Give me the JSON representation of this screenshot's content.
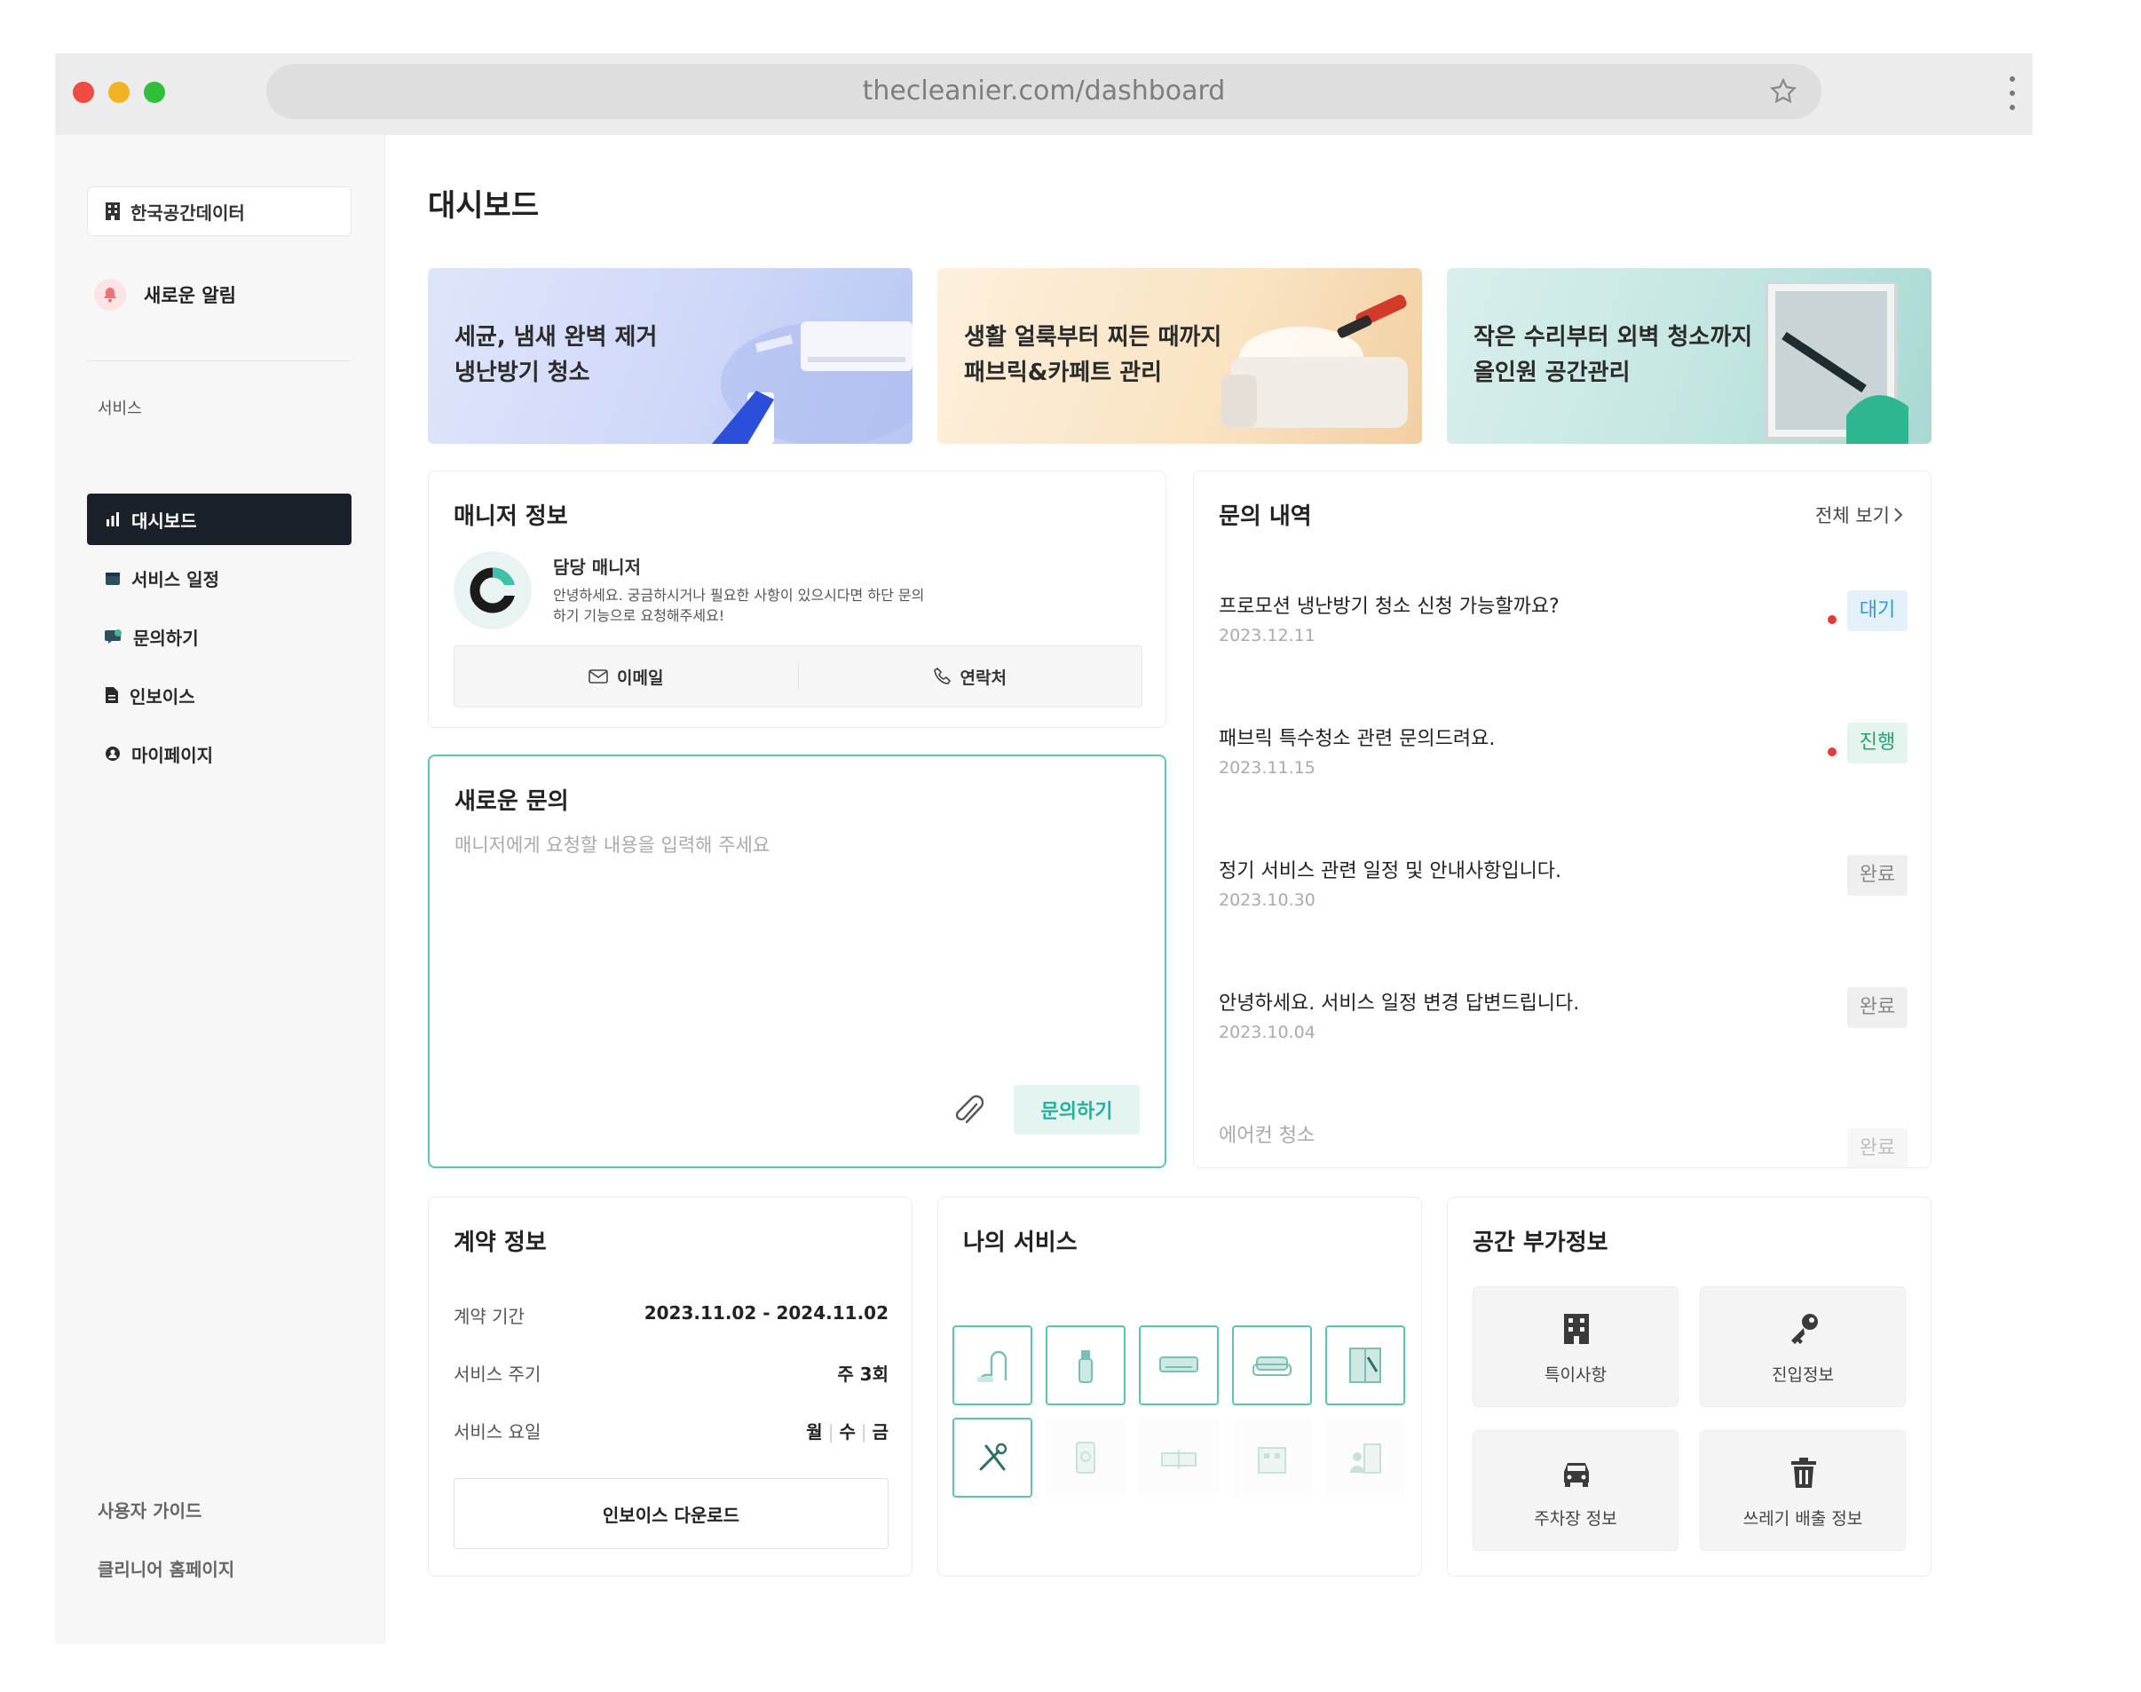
{
  "browser": {
    "url": "thecleanier.com/dashboard"
  },
  "sidebar": {
    "org_name": "한국공간데이터",
    "alert_label": "새로운 알림",
    "section_label": "서비스",
    "items": [
      {
        "label": "대시보드"
      },
      {
        "label": "서비스 일정"
      },
      {
        "label": "문의하기"
      },
      {
        "label": "인보이스"
      },
      {
        "label": "마이페이지"
      }
    ],
    "footer": {
      "guide": "사용자 가이드",
      "homepage": "클리니어 홈페이지"
    }
  },
  "page": {
    "title": "대시보드"
  },
  "banners": [
    {
      "text": "세균, 냄새 완벽 제거\n냉난방기 청소"
    },
    {
      "text": "생활 얼룩부터 찌든 때까지\n패브릭&카페트 관리"
    },
    {
      "text": "작은 수리부터 외벽 청소까지\n올인원 공간관리"
    }
  ],
  "manager": {
    "title": "매니저 정보",
    "name": "담당 매니저",
    "description": "안녕하세요. 궁금하시거나 필요한 사항이 있으시다면 하단 문의하기 기능으로 요청해주세요!",
    "email_label": "이메일",
    "phone_label": "연락처"
  },
  "new_inquiry": {
    "title": "새로운 문의",
    "placeholder": "매니저에게 요청할 내용을 입력해 주세요",
    "submit_label": "문의하기"
  },
  "inquiries": {
    "title": "문의 내역",
    "view_all": "전체 보기",
    "items": [
      {
        "title": "프로모션 냉난방기 청소 신청 가능할까요?",
        "date": "2023.12.11",
        "status": "대기",
        "unread": true
      },
      {
        "title": "패브릭 특수청소 관련 문의드려요.",
        "date": "2023.11.15",
        "status": "진행",
        "unread": true
      },
      {
        "title": "정기 서비스 관련 일정 및 안내사항입니다.",
        "date": "2023.10.30",
        "status": "완료",
        "unread": false
      },
      {
        "title": "안녕하세요. 서비스 일정 변경 답변드립니다.",
        "date": "2023.10.04",
        "status": "완료",
        "unread": false
      },
      {
        "title": "에어컨 청소",
        "date": "",
        "status": "완료",
        "unread": false
      }
    ]
  },
  "contract": {
    "title": "계약 정보",
    "period_label": "계약 기간",
    "period_value": "2023.11.02 - 2024.11.02",
    "cycle_label": "서비스 주기",
    "cycle_value": "주 3회",
    "days_label": "서비스 요일",
    "days": [
      "월",
      "수",
      "금"
    ],
    "invoice_button": "인보이스 다운로드"
  },
  "my_services": {
    "title": "나의 서비스",
    "items": [
      {
        "icon": "vacuum-icon",
        "active": true
      },
      {
        "icon": "spray-bottle-icon",
        "active": true
      },
      {
        "icon": "air-conditioner-icon",
        "active": true
      },
      {
        "icon": "sofa-icon",
        "active": true
      },
      {
        "icon": "window-cleaning-icon",
        "active": true
      },
      {
        "icon": "repair-tools-icon",
        "active": true
      },
      {
        "icon": "air-purifier-icon",
        "active": false
      },
      {
        "icon": "bed-icon",
        "active": false
      },
      {
        "icon": "building-exterior-icon",
        "active": false
      },
      {
        "icon": "person-building-icon",
        "active": false
      }
    ]
  },
  "space_info": {
    "title": "공간 부가정보",
    "tiles": [
      {
        "label": "특이사항",
        "icon": "building-icon"
      },
      {
        "label": "진입정보",
        "icon": "key-icon"
      },
      {
        "label": "주차장 정보",
        "icon": "car-icon"
      },
      {
        "label": "쓰레기 배출 정보",
        "icon": "trash-icon"
      }
    ]
  },
  "colors": {
    "accent": "#5fc4b3",
    "nav_active": "#1b2128",
    "status_wait": "#2d9bd1",
    "status_progress": "#22a36f",
    "status_done": "#888888",
    "unread_dot": "#e53935"
  }
}
